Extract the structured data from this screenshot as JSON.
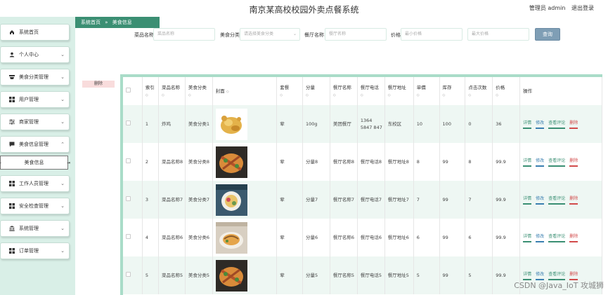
{
  "header": {
    "title": "南京某高校校园外卖点餐系统",
    "user": "管理员 admin",
    "logout": "退出登录"
  },
  "sidebar": {
    "items": [
      {
        "label": "系统首页",
        "icon": "home-icon",
        "chevron": false
      },
      {
        "label": "个人中心",
        "icon": "user-icon",
        "chevron": true
      },
      {
        "label": "美食分类管理",
        "icon": "food-icon",
        "chevron": true
      },
      {
        "label": "用户管理",
        "icon": "grid-icon",
        "chevron": true
      },
      {
        "label": "商家管理",
        "icon": "sliders-icon",
        "chevron": true
      },
      {
        "label": "美食信息管理",
        "icon": "chat-icon",
        "chevron": true,
        "open": true
      },
      {
        "label": "工作人员管理",
        "icon": "grid-icon",
        "chevron": true
      },
      {
        "label": "安全检查管理",
        "icon": "grid-icon",
        "chevron": true
      },
      {
        "label": "系统管理",
        "icon": "bank-icon",
        "chevron": true
      },
      {
        "label": "订单管理",
        "icon": "grid-icon",
        "chevron": true
      }
    ],
    "sub_item": "美食信息"
  },
  "breadcrumb": [
    "系统首页",
    "»",
    "美食信息"
  ],
  "search": {
    "name_label": "菜品名称",
    "name_placeholder": "菜品名称",
    "type_label": "美食分类",
    "type_placeholder": "请选择美食分类",
    "shop_label": "餐厅名称",
    "shop_placeholder": "餐厅名称",
    "price_label": "价格",
    "min_placeholder": "最小价格",
    "max_placeholder": "最大价格",
    "query_button": "查询"
  },
  "delete_button": "删除",
  "table": {
    "headers": [
      "",
      "索引",
      "菜品名称",
      "美食分类",
      "封面",
      "套餐",
      "分量",
      "餐厅名称",
      "餐厅电话",
      "餐厅地址",
      "单價",
      "库存",
      "点击次数",
      "价格",
      "操作"
    ],
    "rows": [
      [
        "1",
        "炸鸡",
        "美食分类1",
        "",
        "荤",
        "100g",
        "美团餐厅",
        "1364 5847 847",
        "东校区",
        "10",
        "100",
        "0",
        "36"
      ],
      [
        "2",
        "菜品名称8",
        "美食分类8",
        "",
        "荤",
        "分量8",
        "餐厅名称8",
        "餐厅电话8",
        "餐厅地址8",
        "8",
        "99",
        "8",
        "99.9"
      ],
      [
        "3",
        "菜品名称7",
        "美食分类7",
        "",
        "荤",
        "分量7",
        "餐厅名称7",
        "餐厅电话7",
        "餐厅地址7",
        "7",
        "99",
        "7",
        "99.9"
      ],
      [
        "4",
        "菜品名称6",
        "美食分类6",
        "",
        "荤",
        "分量6",
        "餐厅名称6",
        "餐厅电话6",
        "餐厅地址6",
        "6",
        "99",
        "6",
        "99.9"
      ],
      [
        "5",
        "菜品名称5",
        "美食分类5",
        "",
        "荤",
        "分量5",
        "餐厅名称5",
        "餐厅电话5",
        "餐厅地址5",
        "5",
        "99",
        "5",
        "99.9"
      ]
    ],
    "actions": [
      "详情",
      "修改",
      "查看评论",
      "删除"
    ]
  },
  "watermark": "CSDN @Java_IoT 攻城狮",
  "colors": {
    "sidebar_bg": "#d9efe7",
    "accent": "#3b8f73",
    "query_btn": "#7f9eb5",
    "delete": "#d24b4b"
  }
}
